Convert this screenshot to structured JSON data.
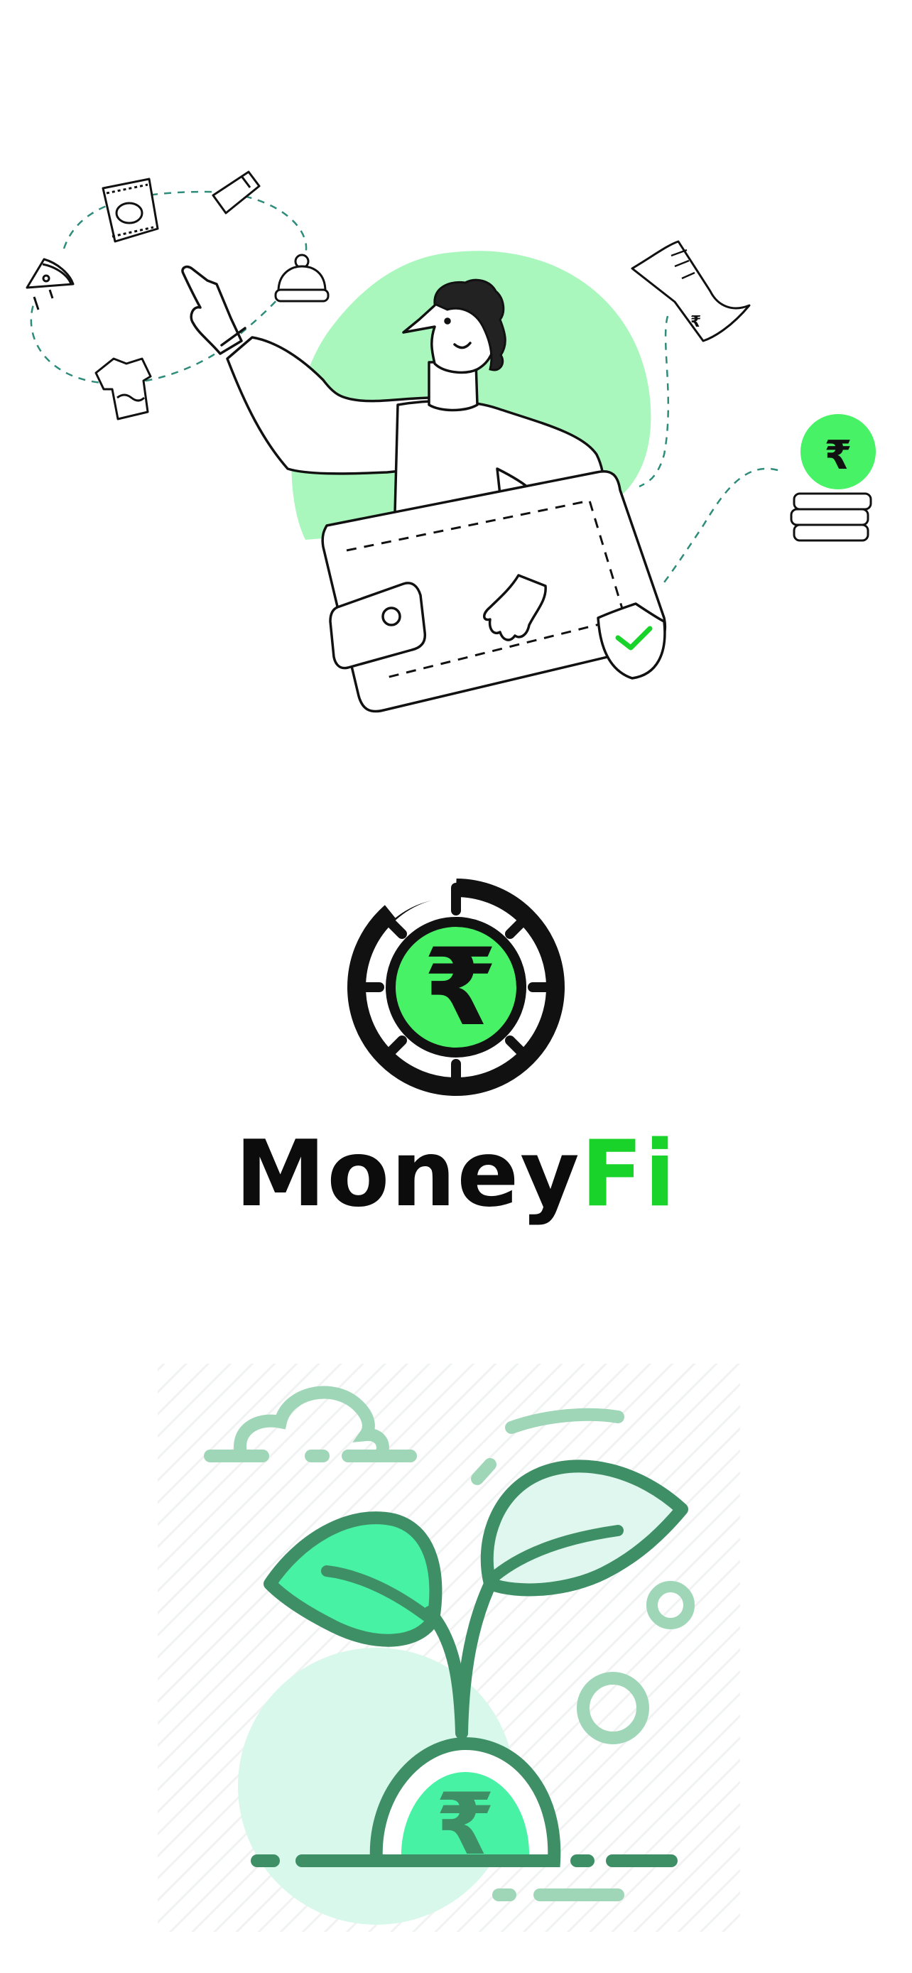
{
  "brand": {
    "name_primary": "Money",
    "name_accent": "Fi"
  },
  "currency_symbol": "₹",
  "receipt_currency_symbol": "₹",
  "colors": {
    "brand_green": "#1ad32a",
    "light_green": "#aaf7bd",
    "coin_green": "#48f266",
    "plant_dark_green": "#3f8f66",
    "plant_light_green": "#9fd6b8",
    "mint": "#d7f8ea",
    "ink": "#111111"
  },
  "icons": {
    "hero": "person-with-wallet-illustration",
    "logo": "rupee-coin-logo",
    "growth": "rupee-plant-illustration",
    "shield": "shield-check-icon"
  }
}
